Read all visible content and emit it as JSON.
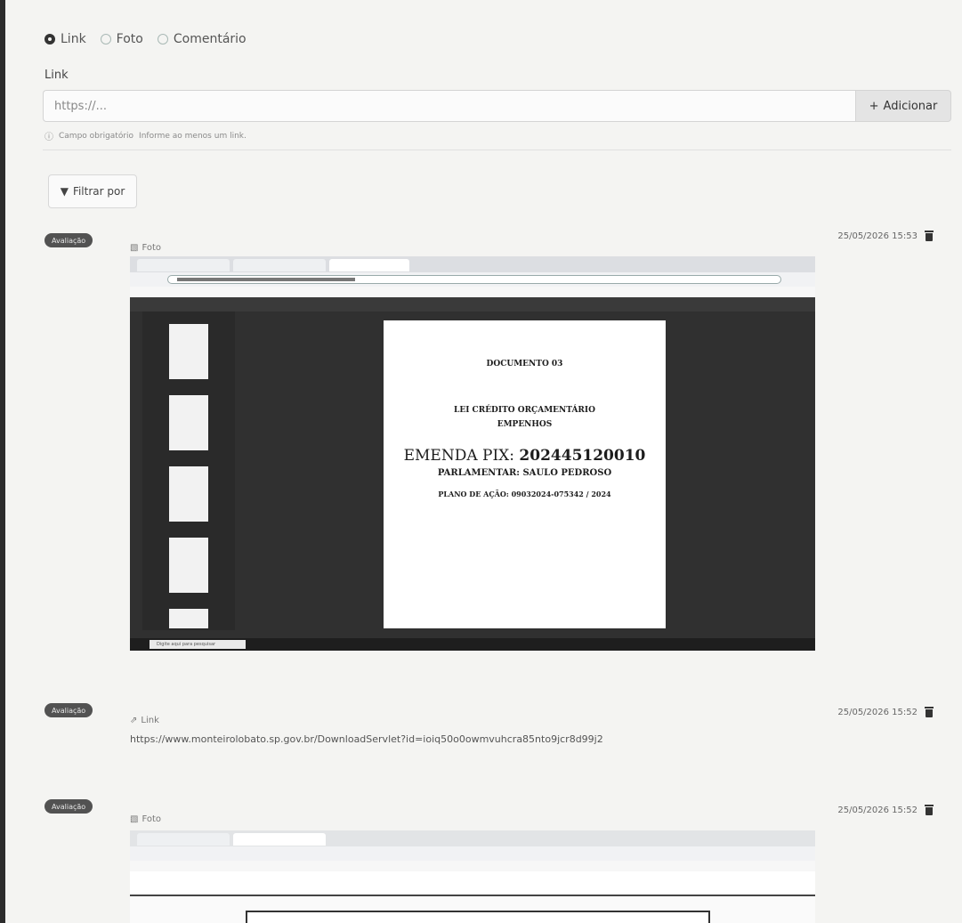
{
  "type_selector": {
    "options": [
      "Link",
      "Foto",
      "Comentário"
    ],
    "selected": "Link"
  },
  "link_field": {
    "label": "Link",
    "placeholder": "https://..."
  },
  "add_button": {
    "label": "Adicionar"
  },
  "validation": {
    "required": "Campo obrigatório",
    "message": "Informe ao menos um link."
  },
  "filter": {
    "label": "Filtrar por"
  },
  "items": [
    {
      "badge": "Avaliação",
      "type": "Foto",
      "timestamp": "25/05/2026 15:53",
      "screenshot": {
        "title": "DOCUMENTO 03",
        "line1": "LEI CRÉDITO ORÇAMENTÁRIO",
        "line2": "EMPENHOS",
        "emenda_label": "EMENDA PIX:",
        "emenda_number": "202445120010",
        "parlamentar": "PARLAMENTAR: SAULO PEDROSO",
        "plano": "PLANO DE AÇÃO: 09032024-075342 / 2024",
        "taskbar_search": "Digite aqui para pesquisar"
      }
    },
    {
      "badge": "Avaliação",
      "type": "Link",
      "timestamp": "25/05/2026 15:52",
      "url": "https://www.monteirolobato.sp.gov.br/DownloadServlet?id=ioiq50o0owmvuhcra85nto9jcr8d99j2"
    },
    {
      "badge": "Avaliação",
      "type": "Foto",
      "timestamp": "25/05/2026 15:52"
    }
  ],
  "colors": {
    "badge_bg": "#525252",
    "button_bg": "#e4e4e4",
    "page_bg": "#f4f4f2"
  },
  "icons": [
    "radio-icon",
    "plus-icon",
    "info-icon",
    "filter-icon",
    "image-icon",
    "link-icon",
    "trash-icon"
  ]
}
